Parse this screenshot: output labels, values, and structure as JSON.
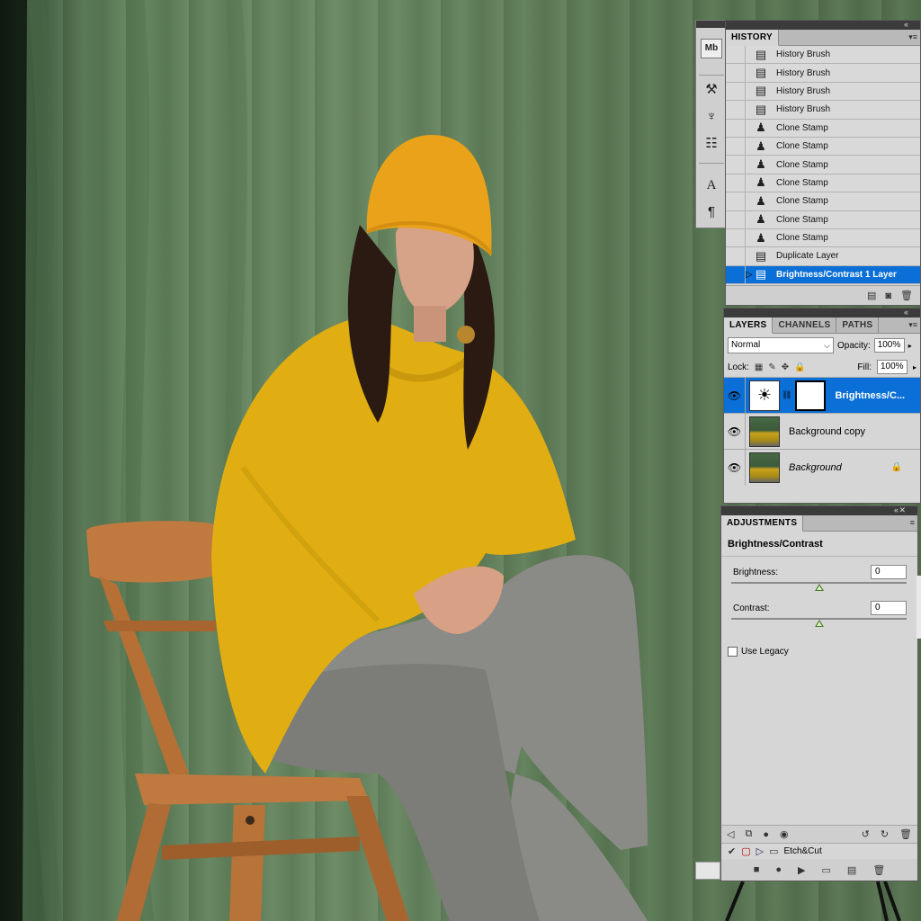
{
  "history": {
    "tab_label": "HISTORY",
    "items": [
      {
        "label": "History Brush",
        "icon": "history-brush-icon"
      },
      {
        "label": "History Brush",
        "icon": "history-brush-icon"
      },
      {
        "label": "History Brush",
        "icon": "history-brush-icon"
      },
      {
        "label": "History Brush",
        "icon": "history-brush-icon"
      },
      {
        "label": "Clone Stamp",
        "icon": "clone-stamp-icon"
      },
      {
        "label": "Clone Stamp",
        "icon": "clone-stamp-icon"
      },
      {
        "label": "Clone Stamp",
        "icon": "clone-stamp-icon"
      },
      {
        "label": "Clone Stamp",
        "icon": "clone-stamp-icon"
      },
      {
        "label": "Clone Stamp",
        "icon": "clone-stamp-icon"
      },
      {
        "label": "Clone Stamp",
        "icon": "clone-stamp-icon"
      },
      {
        "label": "Clone Stamp",
        "icon": "clone-stamp-icon"
      },
      {
        "label": "Duplicate Layer",
        "icon": "history-state-icon"
      },
      {
        "label": "Brightness/Contrast 1 Layer",
        "icon": "history-state-icon",
        "selected": true
      }
    ]
  },
  "tool_strip": {
    "items": [
      "mini-bridge-icon",
      "brush-presets-icon",
      "clone-source-icon",
      "tool-presets-icon",
      "character-icon",
      "paragraph-icon"
    ],
    "mb_label": "Mb"
  },
  "layers": {
    "tabs": [
      "LAYERS",
      "CHANNELS",
      "PATHS"
    ],
    "blend_mode": "Normal",
    "opacity_label": "Opacity:",
    "opacity": "100%",
    "lock_label": "Lock:",
    "fill_label": "Fill:",
    "fill": "100%",
    "items": [
      {
        "name": "Brightness/C...",
        "type": "adjustment",
        "selected": true,
        "visible": true
      },
      {
        "name": "Background copy",
        "type": "photo",
        "visible": true
      },
      {
        "name": "Background",
        "type": "photo",
        "visible": true,
        "locked": true
      }
    ]
  },
  "adjustments": {
    "tab_label": "ADJUSTMENTS",
    "title": "Brightness/Contrast",
    "brightness_label": "Brightness:",
    "brightness_value": "0",
    "contrast_label": "Contrast:",
    "contrast_value": "0",
    "legacy_label": "Use Legacy",
    "use_legacy": false
  },
  "actions": {
    "visible_item": "Etch&Cut"
  },
  "colors": {
    "selection": "#0a6fd6",
    "panel_bg": "#d6d6d6",
    "panel_header": "#3b3b3b"
  }
}
